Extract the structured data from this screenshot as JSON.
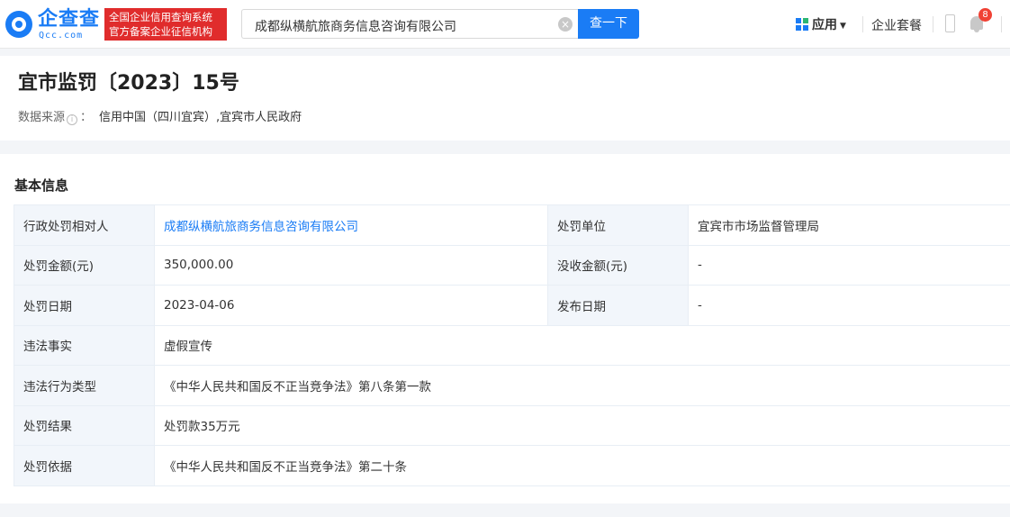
{
  "header": {
    "logo_name": "企查查",
    "logo_domain": "Qcc.com",
    "slogan_line1": "全国企业信用查询系统",
    "slogan_line2": "官方备案企业征信机构",
    "search_value": "成都纵横航旅商务信息咨询有限公司",
    "search_button": "查一下",
    "apps_label": "应用",
    "package_label": "企业套餐",
    "notification_count": "8"
  },
  "title": {
    "heading": "宜市监罚〔2023〕15号",
    "source_label": "数据来源",
    "source_value": "信用中国（四川宜宾）,宜宾市人民政府"
  },
  "basic_info": {
    "section_title": "基本信息",
    "rows": [
      {
        "l1": "行政处罚相对人",
        "v1": "成都纵横航旅商务信息咨询有限公司",
        "l2": "处罚单位",
        "v2": "宜宾市市场监督管理局"
      },
      {
        "l1": "处罚金额(元)",
        "v1": "350,000.00",
        "l2": "没收金额(元)",
        "v2": "-"
      },
      {
        "l1": "处罚日期",
        "v1": "2023-04-06",
        "l2": "发布日期",
        "v2": "-"
      },
      {
        "l1": "违法事实",
        "v1": "虚假宣传"
      },
      {
        "l1": "违法行为类型",
        "v1": "《中华人民共和国反不正当竞争法》第八条第一款"
      },
      {
        "l1": "处罚结果",
        "v1": "处罚款35万元"
      },
      {
        "l1": "处罚依据",
        "v1": "《中华人民共和国反不正当竞争法》第二十条"
      }
    ]
  },
  "colors": {
    "brand_blue": "#1a7cf5",
    "slogan_red": "#e02c2c",
    "label_bg": "#f2f6fb"
  }
}
